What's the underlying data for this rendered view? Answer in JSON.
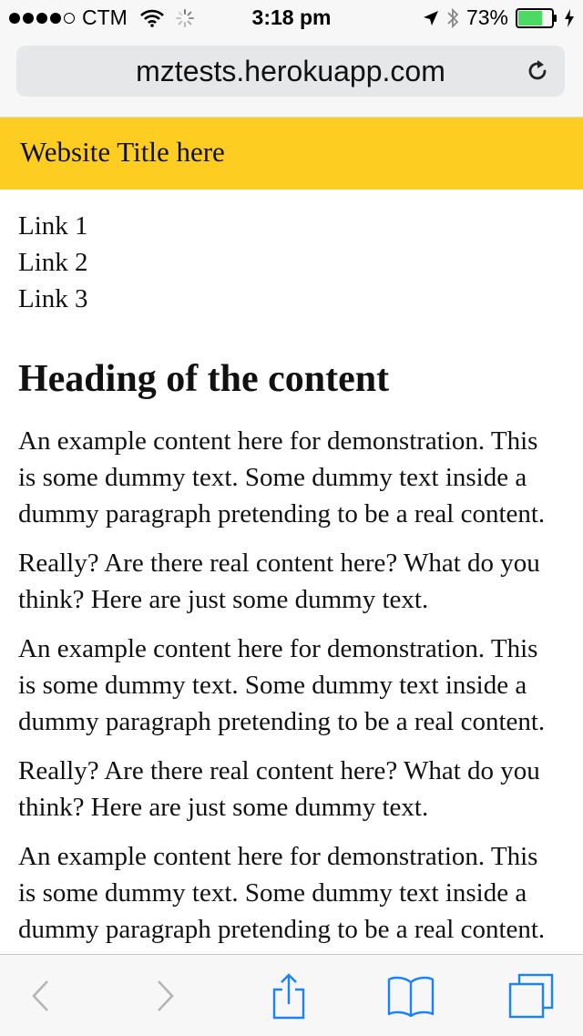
{
  "status_bar": {
    "carrier": "CTM",
    "time": "3:18 pm",
    "battery_percent": "73%",
    "battery_level": 0.73
  },
  "browser": {
    "url": "mztests.herokuapp.com"
  },
  "site": {
    "title": "Website Title here",
    "nav_links": [
      "Link 1",
      "Link 2",
      "Link 3"
    ],
    "heading": "Heading of the content",
    "paragraphs": [
      "An example content here for demonstration. This is some dummy text. Some dummy text inside a dummy paragraph pretending to be a real content.",
      "Really? Are there real content here? What do you think? Here are just some dummy text.",
      "An example content here for demonstration. This is some dummy text. Some dummy text inside a dummy paragraph pretending to be a real content.",
      "Really? Are there real content here? What do you think? Here are just some dummy text.",
      "An example content here for demonstration. This is some dummy text. Some dummy text inside a dummy paragraph pretending to be a real content."
    ]
  },
  "colors": {
    "header_bg": "#fdcd22",
    "toolbar_blue": "#1a82fb",
    "battery_green": "#4cd964"
  },
  "icons": [
    "wifi-icon",
    "loading-spinner-icon",
    "location-arrow-icon",
    "bluetooth-icon",
    "battery-icon",
    "charging-icon",
    "reload-icon",
    "back-arrow-icon",
    "forward-arrow-icon",
    "share-icon",
    "bookmarks-icon",
    "tabs-icon"
  ]
}
